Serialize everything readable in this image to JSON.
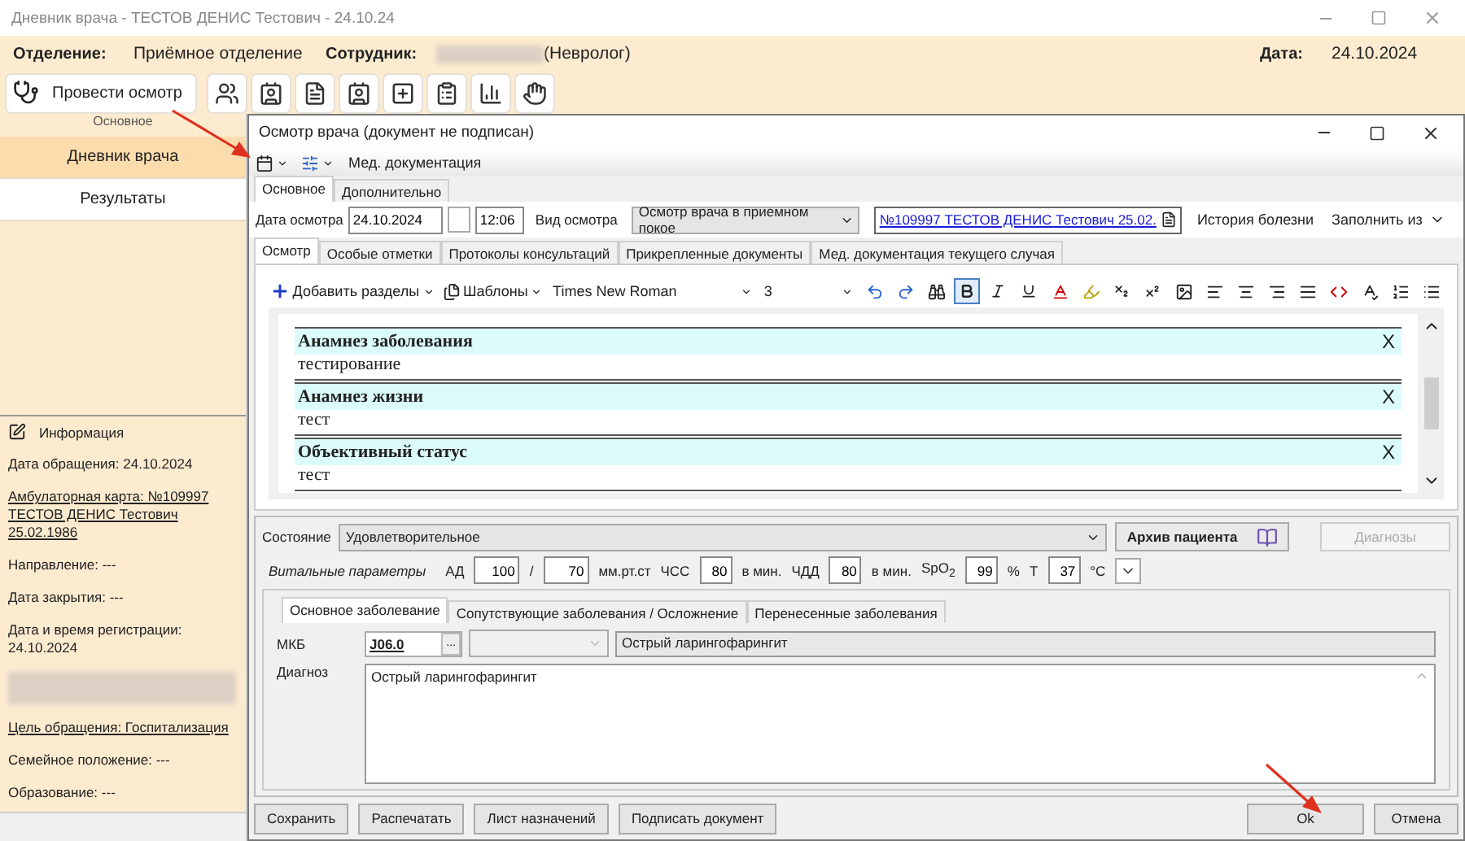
{
  "window": {
    "title": "Дневник врача - ТЕСТОВ ДЕНИС Тестович - 24.10.24"
  },
  "header": {
    "department_label": "Отделение:",
    "department": "Приёмное отделение",
    "employee_label": "Сотрудник:",
    "employee_role": "(Невролог)",
    "date_label": "Дата:",
    "date": "24.10.2024"
  },
  "toolbar": {
    "primary_button": "Провести осмотр",
    "group_label": "Основное"
  },
  "sidebar": {
    "items": [
      {
        "label": "Дневник врача",
        "selected": true
      },
      {
        "label": "Результаты",
        "selected": false
      }
    ],
    "info": {
      "title": "Информация",
      "lines": [
        {
          "kind": "text",
          "text": "Дата обращения: 24.10.2024"
        },
        {
          "kind": "link",
          "text": "Амбулаторная карта: №109997 ТЕСТОВ ДЕНИС Тестович 25.02.1986"
        },
        {
          "kind": "text",
          "text": "Направление: ---"
        },
        {
          "kind": "text",
          "text": "Дата закрытия: ---"
        },
        {
          "kind": "text",
          "text": "Дата и время регистрации: 24.10.2024"
        },
        {
          "kind": "redacted"
        },
        {
          "kind": "link",
          "text": "Цель обращения: Госпитализация"
        },
        {
          "kind": "text",
          "text": "Семейное положение: ---"
        },
        {
          "kind": "text",
          "text": "Образование: ---"
        }
      ]
    }
  },
  "dialog": {
    "title": "Осмотр врача (документ не подписан)",
    "menu_label": "Мед. документация",
    "tabs": [
      {
        "label": "Основное",
        "selected": true
      },
      {
        "label": "Дополнительно",
        "selected": false
      }
    ],
    "exam_date_label": "Дата осмотра",
    "exam_date": "24.10.2024",
    "exam_time": "12:06",
    "exam_type_label": "Вид осмотра",
    "exam_type": "Осмотр врача в приемном покое",
    "patient_link": "№109997 ТЕСТОВ ДЕНИС Тестович 25.02.",
    "history_button": "История болезни",
    "fill_from_button": "Заполнить из",
    "content_tabs": [
      {
        "label": "Осмотр",
        "selected": true
      },
      {
        "label": "Особые отметки",
        "selected": false
      },
      {
        "label": "Протоколы консультаций",
        "selected": false
      },
      {
        "label": "Прикрепленные документы",
        "selected": false
      },
      {
        "label": "Мед. документация текущего случая",
        "selected": false
      }
    ],
    "editor": {
      "add_sections": "Добавить разделы",
      "templates": "Шаблоны",
      "font": "Times New Roman",
      "size": "3",
      "bold": true,
      "italic": false,
      "underline": false,
      "sections": [
        {
          "title": "Анамнез заболевания",
          "body": "тестирование",
          "remove": "X"
        },
        {
          "title": "Анамнез жизни",
          "body": "тест",
          "remove": "X"
        },
        {
          "title": "Объективный статус",
          "body": "тест",
          "remove": "X"
        }
      ]
    },
    "condition": {
      "label": "Состояние",
      "value": "Удовлетворительное",
      "archive_button": "Архив пациента",
      "diagnoses_button": {
        "label": "Диагнозы",
        "disabled": true
      }
    },
    "vitals": {
      "label": "Витальные параметры",
      "fields": [
        {
          "label": "АД",
          "value": "100"
        },
        {
          "label": "/",
          "value": "70",
          "unit": "мм.рт.ст"
        },
        {
          "label": "ЧСС",
          "value": "80",
          "unit": "в мин."
        },
        {
          "label": "ЧДД",
          "value": "80",
          "unit": "в мин."
        },
        {
          "label": "SpO$_{2}$",
          "value": "99",
          "unit": "%"
        },
        {
          "label": "Т",
          "value": "37",
          "unit": "°С"
        }
      ]
    },
    "diagnosis_tabs": [
      {
        "label": "Основное заболевание",
        "selected": true
      },
      {
        "label": "Сопутствующие заболевания / Осложнение",
        "selected": false
      },
      {
        "label": "Перенесенные заболевания",
        "selected": false
      }
    ],
    "mkb_label": "МКБ",
    "mkb_code": "J06.0",
    "mkb_browse": "...",
    "mkb_name": "Острый ларингофарингит",
    "diagnosis_label": "Диагноз",
    "diagnosis_text": "Острый ларингофарингит",
    "buttons": [
      "Сохранить",
      "Распечатать",
      "Лист назначений",
      "Подписать документ"
    ],
    "ok": "Ok",
    "cancel": "Отмена"
  }
}
